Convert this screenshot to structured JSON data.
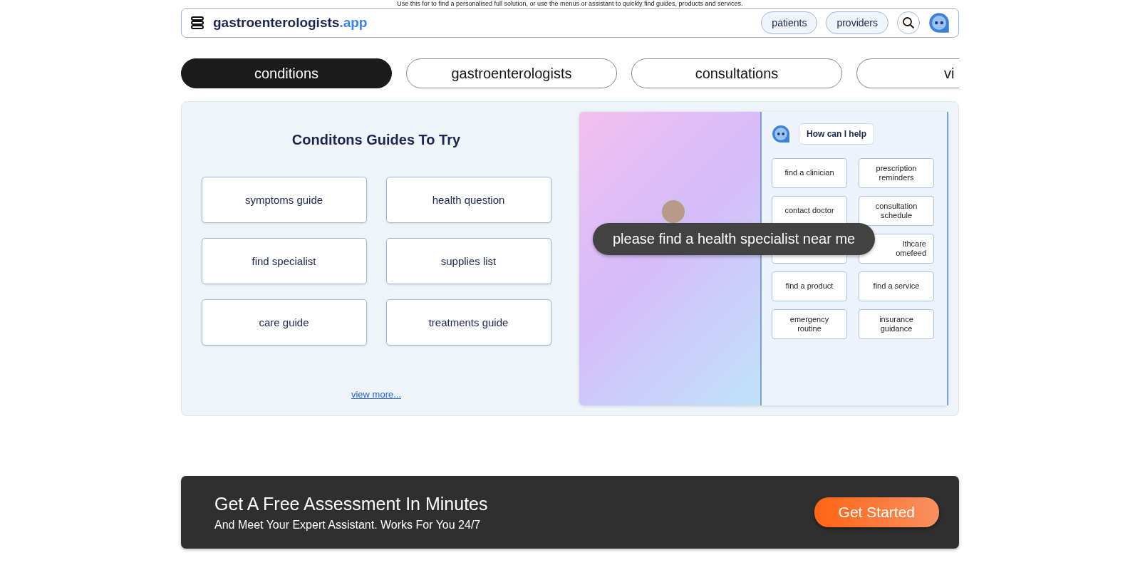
{
  "notice": "Use this for to find a personalised full solution, or use the menus or assistant to quickly find guides, products and services.",
  "nav": {
    "brand": "gastroenterologists",
    "brand_suffix": ".app",
    "links": [
      "patients",
      "providers"
    ]
  },
  "tabs": [
    {
      "label": "conditions",
      "selected": true
    },
    {
      "label": "gastroenterologists",
      "selected": false
    },
    {
      "label": "consultations",
      "selected": false
    },
    {
      "label": "vi",
      "selected": false
    }
  ],
  "guides": {
    "title": "Conditons Guides To Try",
    "items": [
      "symptoms guide",
      "health question",
      "find specialist",
      "supplies list",
      "care guide",
      "treatments guide"
    ],
    "more": "view more..."
  },
  "assistant": {
    "greeting": "How can I help",
    "prompt": "please find a health specialist near me",
    "options": [
      {
        "kind": "card",
        "label": "find a clinician"
      },
      {
        "kind": "card",
        "label": "prescription reminders"
      },
      {
        "kind": "card",
        "label": "contact doctor"
      },
      {
        "kind": "card",
        "label": "consultation schedule"
      },
      {
        "kind": "covered"
      },
      {
        "kind": "covered",
        "label": "lthcare omefeed"
      },
      {
        "kind": "card",
        "label": "find a product"
      },
      {
        "kind": "card",
        "label": "find a service"
      },
      {
        "kind": "card",
        "label": "emergency routine"
      },
      {
        "kind": "card",
        "label": "insurance guidance"
      }
    ]
  },
  "banner": {
    "title": "Get A Free Assessment In Minutes",
    "subtitle": "And Meet Your Expert Assistant. Works For You 24/7",
    "button": "Get Started"
  }
}
